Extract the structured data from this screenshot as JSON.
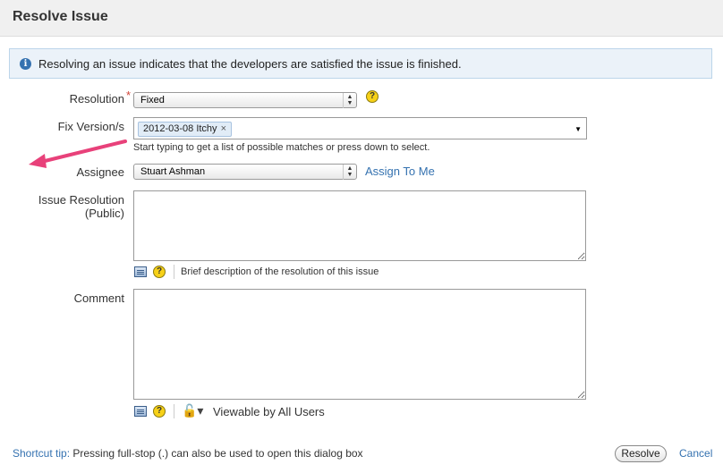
{
  "dialog": {
    "title": "Resolve Issue"
  },
  "info": {
    "message": "Resolving an issue indicates that the developers are satisfied the issue is finished."
  },
  "resolution": {
    "label": "Resolution",
    "required_mark": "*",
    "value": "Fixed"
  },
  "fix_version": {
    "label": "Fix Version/s",
    "chips": [
      "2012-03-08 Itchy"
    ],
    "chip_remove": "×",
    "hint": "Start typing to get a list of possible matches or press down to select."
  },
  "assignee": {
    "label": "Assignee",
    "value": "Stuart Ashman",
    "assign_to_me": "Assign To Me"
  },
  "issue_resolution": {
    "label_line1": "Issue Resolution",
    "label_line2": "(Public)",
    "value": "",
    "hint": "Brief description of the resolution of this issue"
  },
  "comment": {
    "label": "Comment",
    "value": "",
    "visibility": "Viewable by All Users"
  },
  "footer": {
    "tip_label": "Shortcut tip:",
    "tip_text": " Pressing full-stop (.) can also be used to open this dialog box",
    "resolve": "Resolve",
    "cancel": "Cancel"
  },
  "colors": {
    "link": "#3572b0",
    "info_bg": "#ebf2f9",
    "required": "#d04437",
    "arrow": "#e8417a"
  }
}
